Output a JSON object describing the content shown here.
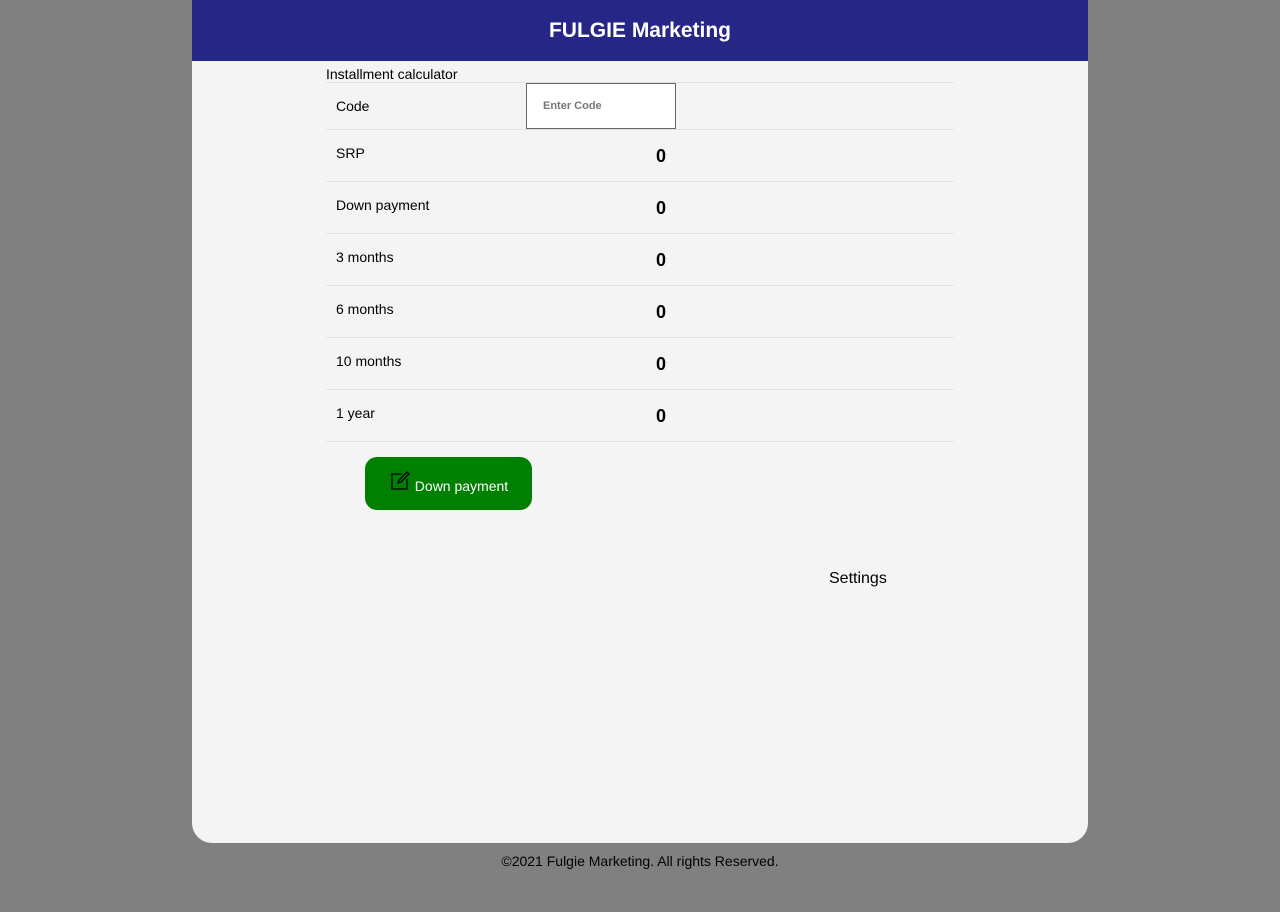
{
  "header": {
    "title": "FULGIE Marketing"
  },
  "calculator": {
    "title": "Installment calculator",
    "code": {
      "label": "Code",
      "placeholder": "Enter Code",
      "value": ""
    },
    "rows": [
      {
        "label": "SRP",
        "value": "0"
      },
      {
        "label": "Down payment",
        "value": "0"
      },
      {
        "label": "3 months",
        "value": "0"
      },
      {
        "label": "6 months",
        "value": "0"
      },
      {
        "label": "10 months",
        "value": "0"
      },
      {
        "label": "1 year",
        "value": "0"
      }
    ]
  },
  "actions": {
    "down_payment_button": {
      "label": "Down payment",
      "icon": "edit-icon",
      "color": "#008000"
    },
    "settings_link": "Settings"
  },
  "footer": {
    "text": "©2021 Fulgie Marketing. All rights Reserved."
  },
  "colors": {
    "header_bg": "#262686",
    "page_bg": "#f4f4f4",
    "outer_bg": "#808080"
  }
}
